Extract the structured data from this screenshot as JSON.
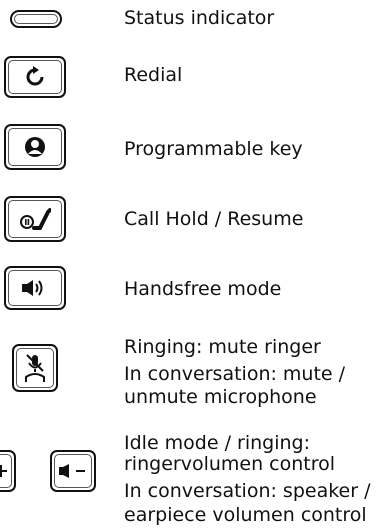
{
  "legend": {
    "status_indicator": "Status indicator",
    "redial": "Redial",
    "programmable_key": "Programmable key",
    "call_hold": "Call Hold / Resume",
    "handsfree": "Handsfree mode",
    "mute": {
      "line1": "Ringing: mute ringer",
      "line2": "In conversation: mute /",
      "line3": "unmute microphone"
    },
    "volume": {
      "line1": "Idle mode / ringing:",
      "line2": "ringervolumen control",
      "line3": "In conversation: speaker /",
      "line4": "earpiece volumen control"
    }
  },
  "icons": [
    "status-led-icon",
    "redial-icon",
    "programmable-key-icon",
    "call-hold-icon",
    "speaker-icon",
    "mute-microphone-icon",
    "volume-up-icon",
    "volume-down-icon"
  ]
}
